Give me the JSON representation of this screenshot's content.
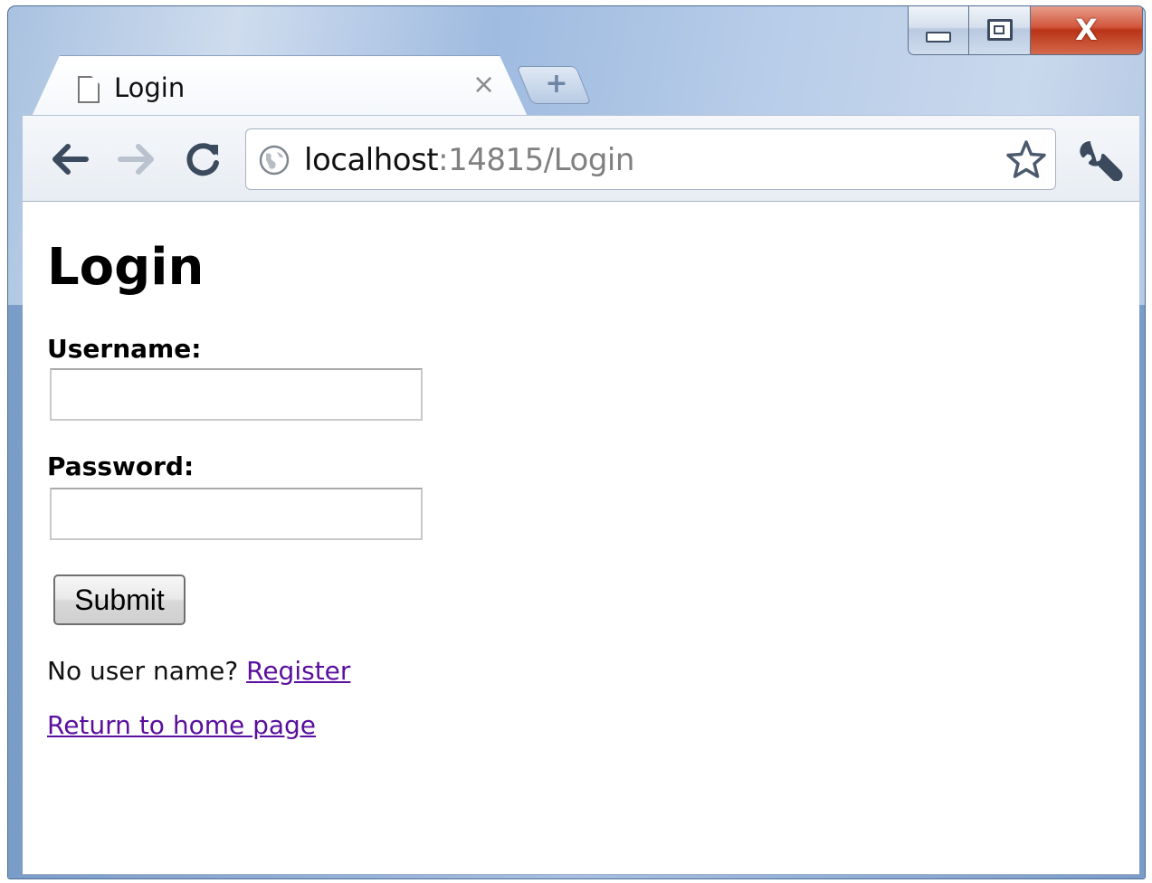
{
  "browser": {
    "tab_title": "Login",
    "tab_close_glyph": "×",
    "new_tab_glyph": "+",
    "url_host": "localhost",
    "url_rest": ":14815/Login",
    "close_glyph": "X"
  },
  "page": {
    "heading": "Login",
    "username_label": "Username:",
    "username_value": "",
    "password_label": "Password:",
    "password_value": "",
    "submit_label": "Submit",
    "register_prompt": "No user name?",
    "register_link": "Register",
    "home_link": "Return to home page"
  },
  "colors": {
    "link_visited": "#5a0f9e",
    "close_button": "#c8452a"
  },
  "icons": [
    "page-icon",
    "back-arrow-icon",
    "forward-arrow-icon",
    "reload-icon",
    "globe-icon",
    "star-icon",
    "wrench-icon"
  ]
}
